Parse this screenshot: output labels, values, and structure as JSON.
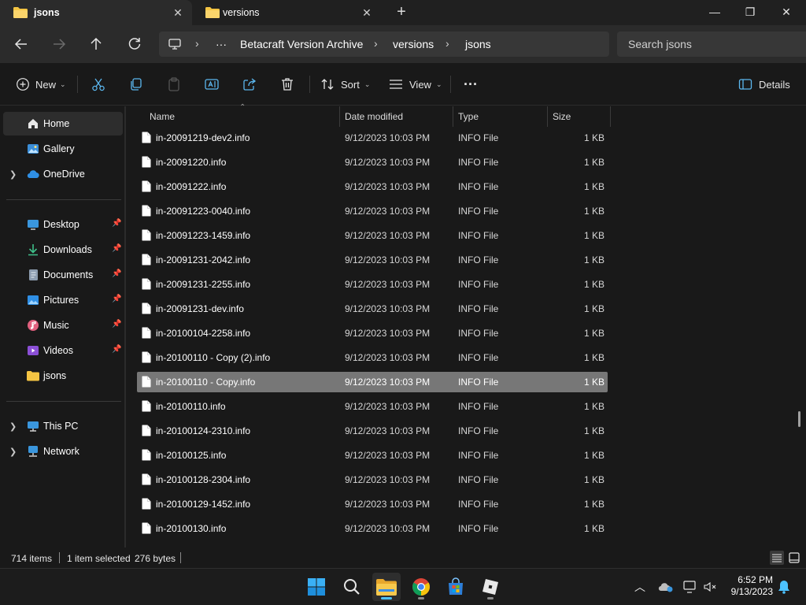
{
  "tabs": [
    {
      "label": "jsons",
      "active": true
    },
    {
      "label": "versions",
      "active": false
    }
  ],
  "address": {
    "more": "···",
    "crumbs": [
      "Betacraft Version Archive",
      "versions",
      "jsons"
    ]
  },
  "search": {
    "placeholder": "Search jsons"
  },
  "commands": {
    "new_label": "New",
    "sort_label": "Sort",
    "view_label": "View",
    "more_label": "···",
    "details_label": "Details"
  },
  "sidebar": {
    "top": [
      {
        "label": "Home",
        "icon": "home-icon"
      },
      {
        "label": "Gallery",
        "icon": "gallery-icon"
      },
      {
        "label": "OneDrive",
        "icon": "cloud-icon"
      }
    ],
    "quick": [
      {
        "label": "Desktop",
        "icon": "desktop-icon"
      },
      {
        "label": "Downloads",
        "icon": "download-icon"
      },
      {
        "label": "Documents",
        "icon": "documents-icon"
      },
      {
        "label": "Pictures",
        "icon": "pictures-icon"
      },
      {
        "label": "Music",
        "icon": "music-icon"
      },
      {
        "label": "Videos",
        "icon": "videos-icon"
      },
      {
        "label": "jsons",
        "icon": "folder-icon"
      }
    ],
    "bottom": [
      {
        "label": "This PC",
        "icon": "computer-icon"
      },
      {
        "label": "Network",
        "icon": "network-icon"
      }
    ]
  },
  "columns": {
    "name": "Name",
    "date": "Date modified",
    "type": "Type",
    "size": "Size"
  },
  "files": [
    {
      "name": "in-20091219-dev2.info",
      "date": "9/12/2023 10:03 PM",
      "type": "INFO File",
      "size": "1 KB"
    },
    {
      "name": "in-20091220.info",
      "date": "9/12/2023 10:03 PM",
      "type": "INFO File",
      "size": "1 KB"
    },
    {
      "name": "in-20091222.info",
      "date": "9/12/2023 10:03 PM",
      "type": "INFO File",
      "size": "1 KB"
    },
    {
      "name": "in-20091223-0040.info",
      "date": "9/12/2023 10:03 PM",
      "type": "INFO File",
      "size": "1 KB"
    },
    {
      "name": "in-20091223-1459.info",
      "date": "9/12/2023 10:03 PM",
      "type": "INFO File",
      "size": "1 KB"
    },
    {
      "name": "in-20091231-2042.info",
      "date": "9/12/2023 10:03 PM",
      "type": "INFO File",
      "size": "1 KB"
    },
    {
      "name": "in-20091231-2255.info",
      "date": "9/12/2023 10:03 PM",
      "type": "INFO File",
      "size": "1 KB"
    },
    {
      "name": "in-20091231-dev.info",
      "date": "9/12/2023 10:03 PM",
      "type": "INFO File",
      "size": "1 KB"
    },
    {
      "name": "in-20100104-2258.info",
      "date": "9/12/2023 10:03 PM",
      "type": "INFO File",
      "size": "1 KB"
    },
    {
      "name": "in-20100110 - Copy (2).info",
      "date": "9/12/2023 10:03 PM",
      "type": "INFO File",
      "size": "1 KB"
    },
    {
      "name": "in-20100110 - Copy.info",
      "date": "9/12/2023 10:03 PM",
      "type": "INFO File",
      "size": "1 KB",
      "selected": true
    },
    {
      "name": "in-20100110.info",
      "date": "9/12/2023 10:03 PM",
      "type": "INFO File",
      "size": "1 KB"
    },
    {
      "name": "in-20100124-2310.info",
      "date": "9/12/2023 10:03 PM",
      "type": "INFO File",
      "size": "1 KB"
    },
    {
      "name": "in-20100125.info",
      "date": "9/12/2023 10:03 PM",
      "type": "INFO File",
      "size": "1 KB"
    },
    {
      "name": "in-20100128-2304.info",
      "date": "9/12/2023 10:03 PM",
      "type": "INFO File",
      "size": "1 KB"
    },
    {
      "name": "in-20100129-1452.info",
      "date": "9/12/2023 10:03 PM",
      "type": "INFO File",
      "size": "1 KB"
    },
    {
      "name": "in-20100130.info",
      "date": "9/12/2023 10:03 PM",
      "type": "INFO File",
      "size": "1 KB"
    }
  ],
  "status": {
    "items": "714 items",
    "selected": "1 item selected",
    "size": "276 bytes"
  },
  "taskbar": {
    "apps": [
      "windows-start-icon",
      "search-icon",
      "file-explorer-icon",
      "chrome-icon",
      "microsoft-store-icon",
      "roblox-icon"
    ],
    "time": "6:52 PM",
    "date": "9/13/2023"
  },
  "colors": {
    "accent": "#4cc2ff",
    "selection": "#777777",
    "folder": "#f5c543"
  }
}
